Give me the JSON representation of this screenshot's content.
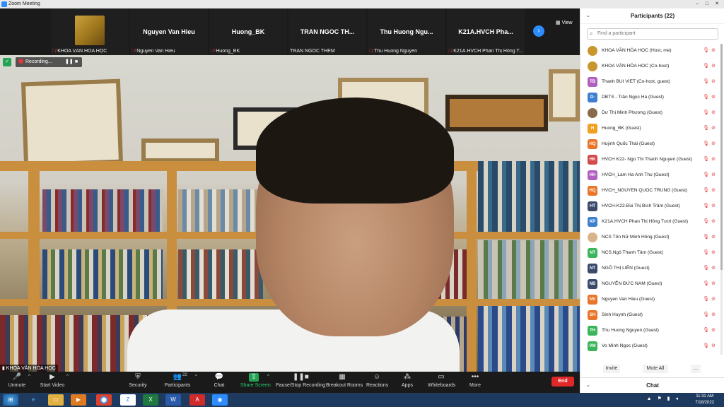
{
  "window": {
    "title": "Zoom Meeting",
    "controls": [
      "–",
      "□",
      "✕"
    ]
  },
  "thumbnails": [
    {
      "display": "",
      "label": "KHOA VĂN HÓA HỌC",
      "has_image": true
    },
    {
      "display": "Nguyen Van Hieu",
      "label": "Nguyen Van Hieu"
    },
    {
      "display": "Huong_BK",
      "label": "Huong_BK"
    },
    {
      "display": "TRAN NGOC TH...",
      "label": "TRAN NGOC THEM"
    },
    {
      "display": "Thu Huong Ngu...",
      "label": "Thu Huong Nguyen"
    },
    {
      "display": "K21A.HVCH Pha...",
      "label": "K21A.HVCH Phan Thị Hồng T..."
    }
  ],
  "view_label": "View",
  "recording": {
    "label": "Recording..."
  },
  "speaker_label": "KHOA VĂN HÓA HỌC",
  "toolbar": {
    "unmute": "Unmute",
    "start_video": "Start Video",
    "security": "Security",
    "participants": "Participants",
    "participants_count": "22",
    "chat": "Chat",
    "share_screen": "Share Screen",
    "pause_recording": "Pause/Stop Recording",
    "breakout_rooms": "Breakout Rooms",
    "reactions": "Reactions",
    "apps": "Apps",
    "whiteboards": "Whiteboards",
    "more": "More",
    "end": "End"
  },
  "panel": {
    "title": "Participants (22)",
    "search_placeholder": "Find a participant",
    "invite": "Invite",
    "mute_all": "Mute All",
    "more": "...",
    "chat_title": "Chat",
    "participants": [
      {
        "initials": "",
        "name": "KHOA VĂN HÓA HỌC (Host, me)",
        "color": "#c9962e",
        "img": true
      },
      {
        "initials": "",
        "name": "KHOA VĂN HÓA HỌC (Co-host)",
        "color": "#c9962e",
        "img": true
      },
      {
        "initials": "TB",
        "name": "Thanh BUI VIET (Co-host, guest)",
        "color": "#b15fbf"
      },
      {
        "initials": "D-",
        "name": "DBTS - Trần Ngọc Hà (Guest)",
        "color": "#3f7fd0"
      },
      {
        "initials": "",
        "name": "Dư Thị Minh Phương (Guest)",
        "color": "#8a6a4a",
        "img": true
      },
      {
        "initials": "H",
        "name": "Huong_BK (Guest)",
        "color": "#f0a020"
      },
      {
        "initials": "HQ",
        "name": "Huỳnh Quốc Thái (Guest)",
        "color": "#e9742a"
      },
      {
        "initials": "HK",
        "name": "HVCH K22- Ngo Thi Thanh Nguyen (Guest)",
        "color": "#d24a4a"
      },
      {
        "initials": "HH",
        "name": "HVCH_Lam Ha Anh Thu (Guest)",
        "color": "#b15fbf"
      },
      {
        "initials": "HQ",
        "name": "HVCH_NGUYEN QUOC TRUNG (Guest)",
        "color": "#e9742a"
      },
      {
        "initials": "HT",
        "name": "HVCH-K22-Bùi Thị Bích Trâm (Guest)",
        "color": "#3b4a6b"
      },
      {
        "initials": "KP",
        "name": "K21A.HVCH Phan Thị Hồng Tươi (Guest)",
        "color": "#3f7fd0"
      },
      {
        "initials": "",
        "name": "NCS Tôn Nữ Minh Hồng (Guest)",
        "color": "#d9b48a",
        "img": true
      },
      {
        "initials": "NT",
        "name": "NCS.Ngô Thanh Tâm (Guest)",
        "color": "#3bb55a"
      },
      {
        "initials": "NT",
        "name": "NGÔ THỊ LIÊN (Guest)",
        "color": "#3b4a6b"
      },
      {
        "initials": "NĐ",
        "name": "NGUYỄN ĐỨC NAM (Guest)",
        "color": "#3b4a6b"
      },
      {
        "initials": "NV",
        "name": "Nguyen Van Hieu (Guest)",
        "color": "#e9742a"
      },
      {
        "initials": "SH",
        "name": "Sinh Huynh (Guest)",
        "color": "#e9742a"
      },
      {
        "initials": "TH",
        "name": "Thu Huong Nguyen (Guest)",
        "color": "#3bb55a"
      },
      {
        "initials": "VM",
        "name": "Vo Minh Ngoc (Guest)",
        "color": "#3bb55a"
      }
    ]
  },
  "taskbar": {
    "time": "11:31 AM",
    "date": "7/18/2022"
  }
}
